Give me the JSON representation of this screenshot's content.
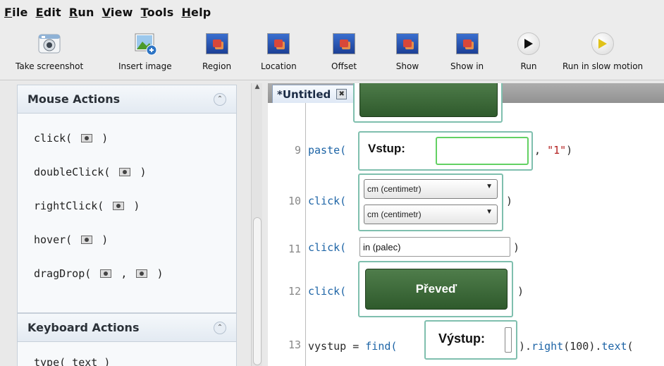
{
  "menubar": {
    "items": [
      {
        "label": "File",
        "mnemonic": "F",
        "rest": "ile"
      },
      {
        "label": "Edit",
        "mnemonic": "E",
        "rest": "dit"
      },
      {
        "label": "Run",
        "mnemonic": "R",
        "rest": "un"
      },
      {
        "label": "View",
        "mnemonic": "V",
        "rest": "iew"
      },
      {
        "label": "Tools",
        "mnemonic": "T",
        "rest": "ools"
      },
      {
        "label": "Help",
        "mnemonic": "H",
        "rest": "elp"
      }
    ]
  },
  "toolbar": {
    "take_screenshot": {
      "label": "Take screenshot",
      "icon": "camera-icon"
    },
    "insert_image": {
      "label": "Insert image",
      "icon": "insert-image-icon"
    },
    "region": {
      "label": "Region",
      "icon": "image-icon"
    },
    "location": {
      "label": "Location",
      "icon": "image-icon"
    },
    "offset": {
      "label": "Offset",
      "icon": "image-icon"
    },
    "show": {
      "label": "Show",
      "icon": "image-icon"
    },
    "show_in": {
      "label": "Show in",
      "icon": "image-icon"
    },
    "run": {
      "label": "Run",
      "icon": "play-icon",
      "color": "#111111"
    },
    "run_slow": {
      "label": "Run in slow motion",
      "icon": "play-icon",
      "color": "#e0c21a"
    }
  },
  "sidebar": {
    "mouse_actions": {
      "title": "Mouse Actions",
      "items": [
        {
          "prefix": "click(",
          "suffix": ")"
        },
        {
          "prefix": "doubleClick(",
          "suffix": ")"
        },
        {
          "prefix": "rightClick(",
          "suffix": ")"
        },
        {
          "prefix": "hover(",
          "suffix": ")"
        },
        {
          "prefix": "dragDrop(",
          "middle": ",",
          "suffix": ")"
        }
      ]
    },
    "keyboard_actions": {
      "title": "Keyboard Actions",
      "first_item": "type( text )"
    }
  },
  "editor": {
    "tab_title": "*Untitled",
    "lines": {
      "l9": {
        "num": "9",
        "fn": "paste(",
        "capture_label": "Vstup:",
        "rest": ", ",
        "str": "\"1\"",
        "close": ")"
      },
      "l10": {
        "num": "10",
        "fn": "click(",
        "combo1": "cm (centimetr)",
        "combo2": "cm (centimetr)",
        "close": ")"
      },
      "l11": {
        "num": "11",
        "fn": "click(",
        "field": "in (palec)",
        "close": ")"
      },
      "l12": {
        "num": "12",
        "fn": "click(",
        "button": "Převeď",
        "close": ")"
      },
      "l13": {
        "num": "13",
        "pre": "vystup = ",
        "fn": "find(",
        "capture_label": "Výstup:",
        "mid": ").",
        "fn2": "right",
        "arg": "(100).",
        "fn3": "text",
        "tail": "("
      }
    }
  }
}
